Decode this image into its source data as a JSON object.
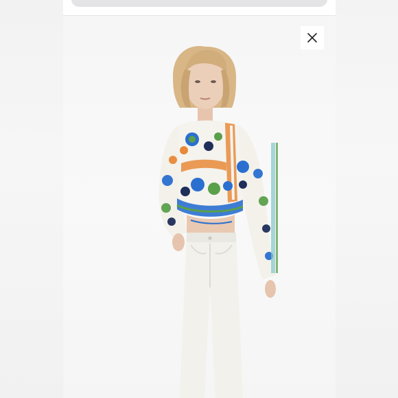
{
  "viewer": {
    "close_label": "Close",
    "close_icon": "close-icon"
  },
  "photo": {
    "subject": "model-wearing-printed-crop-top-and-white-jeans",
    "colors": {
      "top_base": "#f4f3ee",
      "print_blue": "#2a6fd0",
      "print_green": "#5aa04a",
      "print_orange": "#e8893a",
      "print_navy": "#1f2f5a",
      "jeans": "#f2f1ec",
      "hair": "#d7b483",
      "skin": "#e9c9b2"
    }
  }
}
